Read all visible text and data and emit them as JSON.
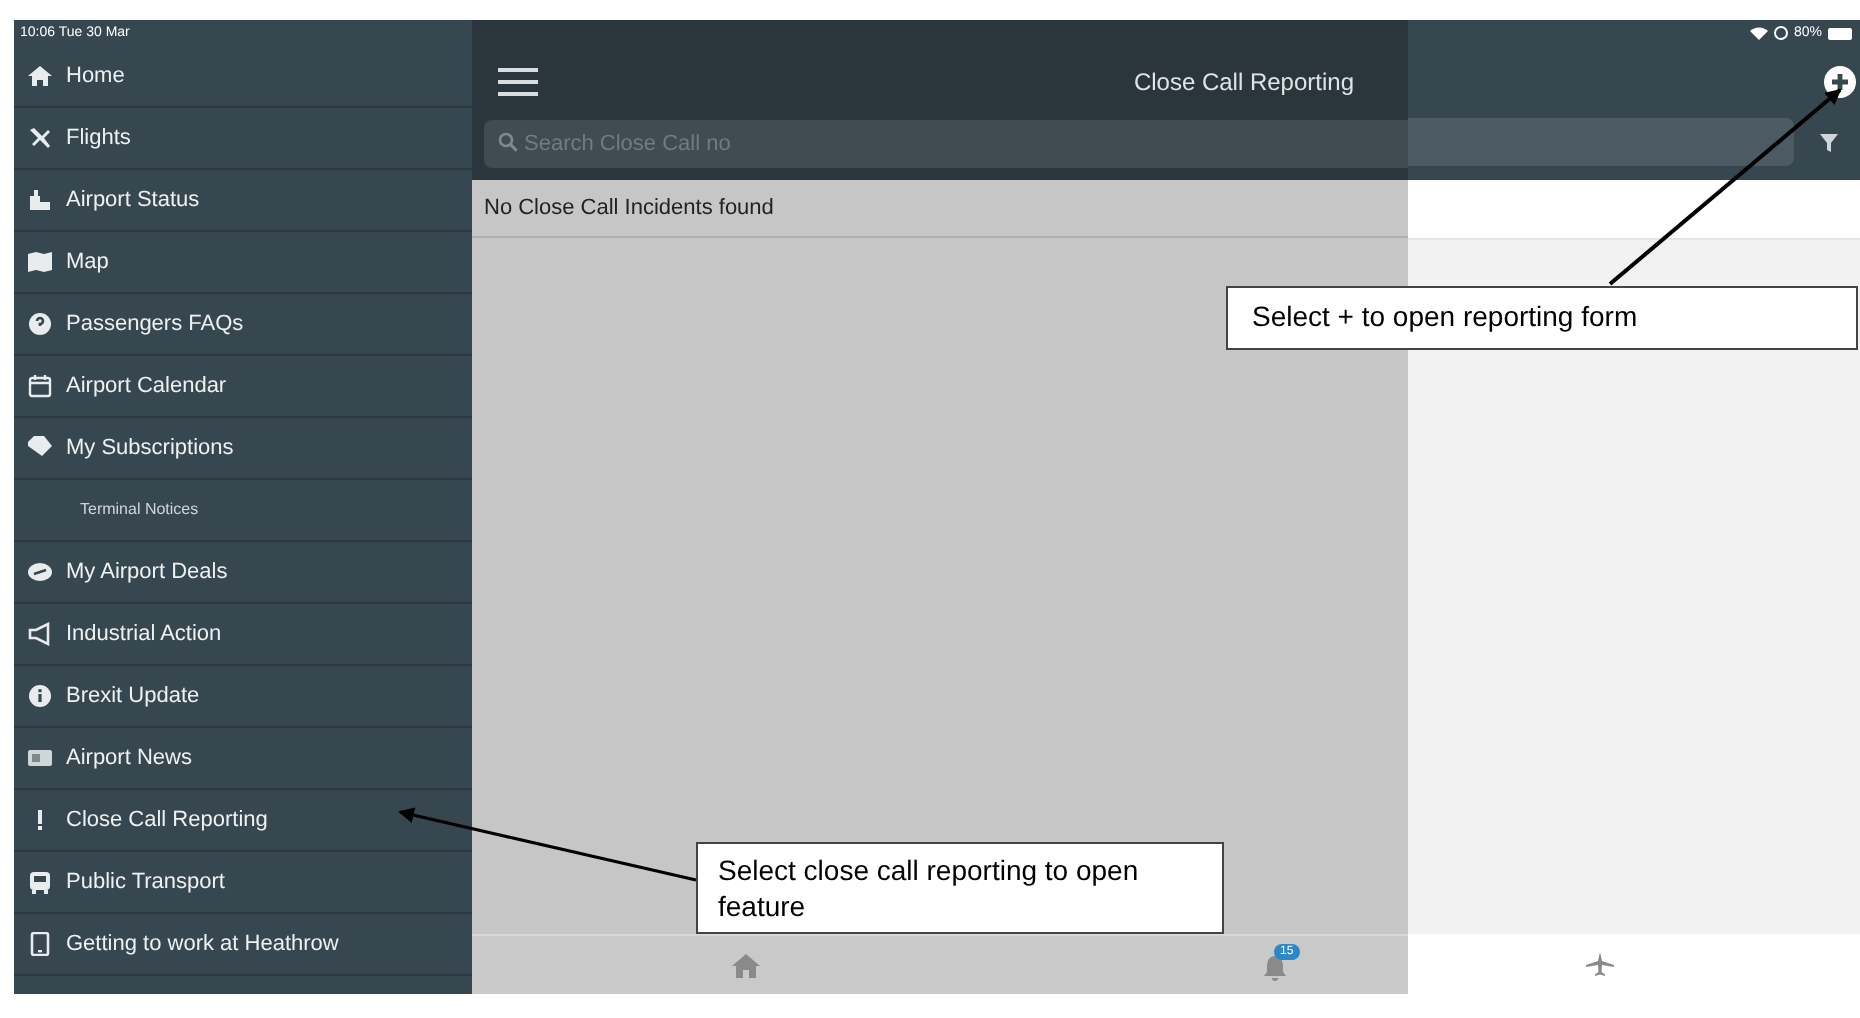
{
  "status_bar": {
    "time": "10:06  Tue 30 Mar",
    "battery": "80%"
  },
  "sidebar": {
    "items": [
      {
        "label": "Home",
        "kind": "item"
      },
      {
        "label": "Flights",
        "kind": "item"
      },
      {
        "label": "Airport Status",
        "kind": "item"
      },
      {
        "label": "Map",
        "kind": "item"
      },
      {
        "label": "Passengers FAQs",
        "kind": "item"
      },
      {
        "label": "Airport Calendar",
        "kind": "item"
      },
      {
        "label": "My Subscriptions",
        "kind": "item"
      },
      {
        "label": "Terminal Notices",
        "kind": "subitem"
      },
      {
        "label": "My Airport Deals",
        "kind": "item"
      },
      {
        "label": "Industrial Action",
        "kind": "item"
      },
      {
        "label": "Brexit Update",
        "kind": "item"
      },
      {
        "label": "Airport News",
        "kind": "item"
      },
      {
        "label": "Close Call Reporting",
        "kind": "item"
      },
      {
        "label": "Public Transport",
        "kind": "item"
      },
      {
        "label": "Getting to work at Heathrow",
        "kind": "item"
      }
    ]
  },
  "header": {
    "title": "Close Call Reporting",
    "search": {
      "placeholder": "Search Close Call no"
    }
  },
  "content": {
    "message": "No Close Call Incidents found"
  },
  "tab_bar": {
    "notifications_badge": "15"
  },
  "callouts": [
    {
      "text": "Select + to open reporting form"
    },
    {
      "text": "Select close call reporting to open feature"
    }
  ]
}
